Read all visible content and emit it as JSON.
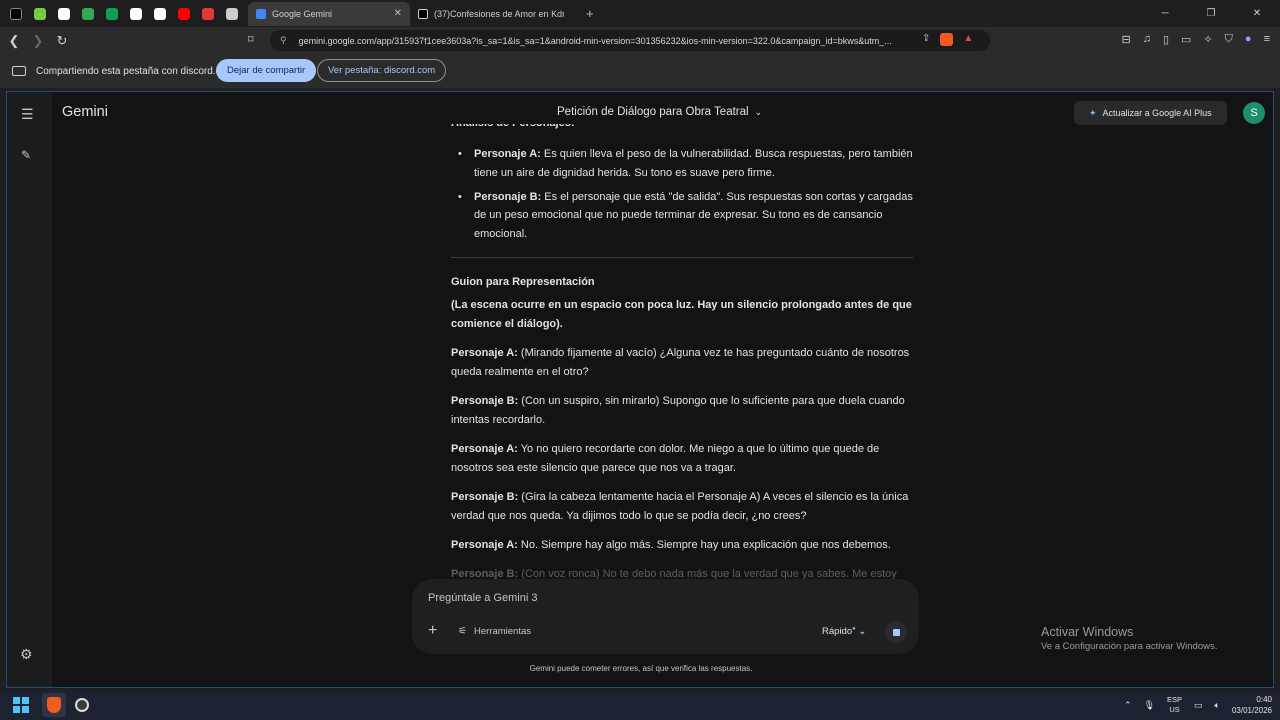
{
  "browser": {
    "tabs": [
      {
        "title": "Google Gemini",
        "active": true
      },
      {
        "title": "(37)Confesiones de Amor en Kdrama",
        "active": false
      }
    ],
    "url": "gemini.google.com/app/315937f1cee3603a?is_sa=1&is_sa=1&android-min-version=301356232&ios-min-version=322.0&campaign_id=bkws&utm_...",
    "pinned_colors": [
      "#000000",
      "#7ac943",
      "#ffffff",
      "#34a853",
      "#0f9d58",
      "#ffffff",
      "#ffffff",
      "#ff0000",
      "#e53935",
      "#cccccc"
    ]
  },
  "sharebar": {
    "text": "Compartiendo esta pestaña con discord.com",
    "stop_label": "Dejar de compartir",
    "view_label": "Ver pestaña: discord.com"
  },
  "gemini": {
    "brand": "Gemini",
    "conversation_title": "Petición de Diálogo para Obra Teatral",
    "upgrade_label": "Actualizar a Google AI Plus",
    "avatar_initial": "S",
    "cut_heading": "Análisis de Personajes:",
    "bullets": [
      {
        "name": "Personaje A:",
        "text": " Es quien lleva el peso de la vulnerabilidad. Busca respuestas, pero también tiene un aire de dignidad herida. Su tono es suave pero firme."
      },
      {
        "name": "Personaje B:",
        "text": " Es el personaje que está \"de salida\". Sus respuestas son cortas y cargadas de un peso emocional que no puede terminar de expresar. Su tono es de cansancio emocional."
      }
    ],
    "section_title": "Guion para Representación",
    "stage_direction": "(La escena ocurre en un espacio con poca luz. Hay un silencio prolongado antes de que comience el diálogo).",
    "dialogue": [
      {
        "speaker": "Personaje A:",
        "text": " (Mirando fijamente al vacío) ¿Alguna vez te has preguntado cuánto de nosotros queda realmente en el otro?"
      },
      {
        "speaker": "Personaje B:",
        "text": " (Con un suspiro, sin mirarlo) Supongo que lo suficiente para que duela cuando intentas recordarlo."
      },
      {
        "speaker": "Personaje A:",
        "text": " Yo no quiero recordarte con dolor. Me niego a que lo último que quede de nosotros sea este silencio que parece que nos va a tragar."
      },
      {
        "speaker": "Personaje B:",
        "text": " (Gira la cabeza lentamente hacia el Personaje A) A veces el silencio es la única verdad que nos queda. Ya dijimos todo lo que se podía decir, ¿no crees?"
      },
      {
        "speaker": "Personaje A:",
        "text": " No. Siempre hay algo más. Siempre hay una explicación que nos debemos."
      },
      {
        "speaker": "Personaje B:",
        "text": " (Con voz ronca) No te debo nada más que la verdad que ya sabes. Me estoy"
      }
    ],
    "composer_placeholder": "Pregúntale a Gemini 3",
    "tools_label": "Herramientas",
    "mode_label": "Rápido",
    "disclaimer": "Gemini puede cometer errores, así que verifica las respuestas."
  },
  "watermark": {
    "line1": "Activar Windows",
    "line2": "Ve a Configuración para activar Windows."
  },
  "taskbar": {
    "lang_top": "ESP",
    "lang_bottom": "US",
    "time": "0:40",
    "date": "03/01/2026"
  }
}
